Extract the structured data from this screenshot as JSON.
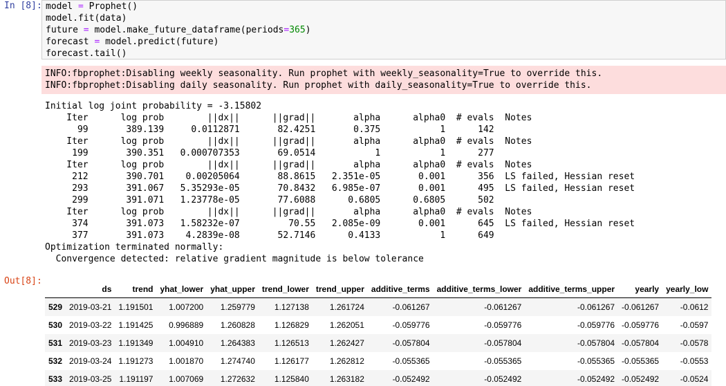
{
  "prompts": {
    "in": "In [8]:",
    "out": "Out[8]:"
  },
  "code": {
    "line1": {
      "a": "model ",
      "op": "=",
      "b": " Prophet()"
    },
    "line2": {
      "a": "model.fit(data)"
    },
    "line3": {
      "a": "future ",
      "op": "=",
      "b": " model.make_future_dataframe(periods",
      "op2": "=",
      "num": "365",
      "c": ")"
    },
    "line4": {
      "a": "forecast ",
      "op": "=",
      "b": " model.predict(future)"
    },
    "line5": {
      "a": "forecast.tail()"
    }
  },
  "stderr": [
    "INFO:fbprophet:Disabling weekly seasonality. Run prophet with weekly_seasonality=True to override this.",
    "INFO:fbprophet:Disabling daily seasonality. Run prophet with daily_seasonality=True to override this."
  ],
  "stdout": [
    "Initial log joint probability = -3.15802",
    "    Iter      log prob        ||dx||      ||grad||       alpha      alpha0  # evals  Notes",
    "      99       389.139     0.0112871       82.4251       0.375           1      142",
    "    Iter      log prob        ||dx||      ||grad||       alpha      alpha0  # evals  Notes",
    "     199       390.351   0.000707353       69.0514           1           1      277",
    "    Iter      log prob        ||dx||      ||grad||       alpha      alpha0  # evals  Notes",
    "     212       390.701    0.00205064       88.8615   2.351e-05       0.001      356  LS failed, Hessian reset",
    "     293       391.067   5.35293e-05       70.8432   6.985e-07       0.001      495  LS failed, Hessian reset",
    "     299       391.071   1.23778e-05       77.6088      0.6805      0.6805      502",
    "    Iter      log prob        ||dx||      ||grad||       alpha      alpha0  # evals  Notes",
    "     374       391.073   1.58232e-07         70.55   2.085e-09       0.001      645  LS failed, Hessian reset",
    "     377       391.073    4.2839e-08       52.7146      0.4133           1      649",
    "Optimization terminated normally:",
    "  Convergence detected: relative gradient magnitude is below tolerance"
  ],
  "dataframe": {
    "columns": [
      "",
      "ds",
      "trend",
      "yhat_lower",
      "yhat_upper",
      "trend_lower",
      "trend_upper",
      "additive_terms",
      "additive_terms_lower",
      "additive_terms_upper",
      "yearly",
      "yearly_low"
    ],
    "rows": [
      [
        "529",
        "2019-03-21",
        "1.191501",
        "1.007200",
        "1.259779",
        "1.127138",
        "1.261724",
        "-0.061267",
        "-0.061267",
        "-0.061267",
        "-0.061267",
        "-0.0612"
      ],
      [
        "530",
        "2019-03-22",
        "1.191425",
        "0.996889",
        "1.260828",
        "1.126829",
        "1.262051",
        "-0.059776",
        "-0.059776",
        "-0.059776",
        "-0.059776",
        "-0.0597"
      ],
      [
        "531",
        "2019-03-23",
        "1.191349",
        "1.004910",
        "1.264383",
        "1.126513",
        "1.262427",
        "-0.057804",
        "-0.057804",
        "-0.057804",
        "-0.057804",
        "-0.0578"
      ],
      [
        "532",
        "2019-03-24",
        "1.191273",
        "1.001870",
        "1.274740",
        "1.126177",
        "1.262812",
        "-0.055365",
        "-0.055365",
        "-0.055365",
        "-0.055365",
        "-0.0553"
      ],
      [
        "533",
        "2019-03-25",
        "1.191197",
        "1.007069",
        "1.272632",
        "1.125840",
        "1.263182",
        "-0.052492",
        "-0.052492",
        "-0.052492",
        "-0.052492",
        "-0.0524"
      ]
    ]
  }
}
